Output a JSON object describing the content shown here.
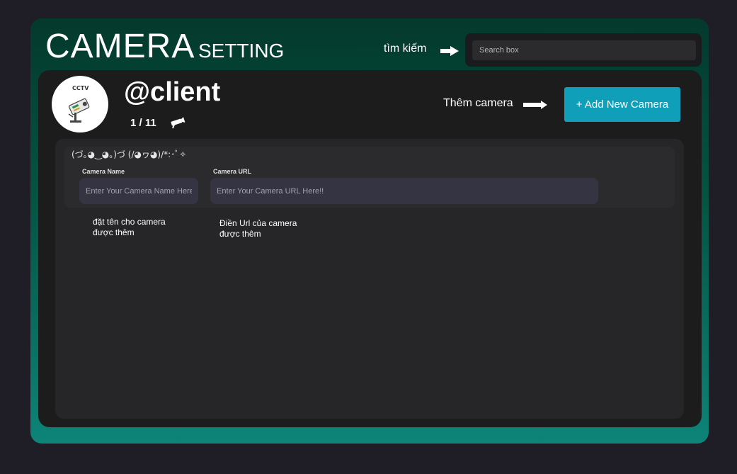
{
  "header": {
    "title": "CAMERA",
    "subtitle": "SETTING",
    "search_hint": "tìm kiếm",
    "search_placeholder": "Search box"
  },
  "profile": {
    "avatar_text": "CCTV",
    "username": "@client",
    "camera_count": "1 / 11"
  },
  "actions": {
    "add_hint": "Thêm camera",
    "add_button_label": "+ Add New Camera"
  },
  "form": {
    "kaomoji": "(づ｡◕‿◕｡)づ  (/◕ヮ◕)/*:･ﾟ✧",
    "name_label": "Camera Name",
    "name_placeholder": "Enter Your Camera Name Here!!",
    "url_label": "Camera URL",
    "url_placeholder": "Enter Your Camera URL Here!!",
    "name_note_line1": "đặt tên cho camera",
    "name_note_line2": "được thêm",
    "url_note_line1": "Điền Url của camera",
    "url_note_line2": "được thêm"
  },
  "colors": {
    "accent": "#0f9fb9",
    "frame_top": "#04392c",
    "frame_bottom": "#0d8478",
    "panel": "#1c1c1d"
  },
  "icons": {
    "arrow": "arrow-right-icon",
    "camera": "camera-icon",
    "cctv": "cctv-icon"
  }
}
